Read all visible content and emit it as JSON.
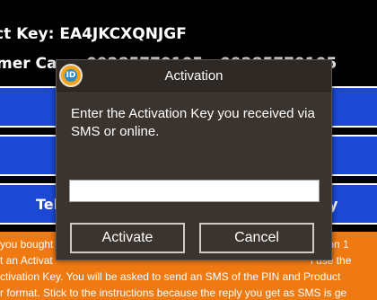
{
  "background": {
    "product_key_line": "ct Key: EA4JKCXQNJGF",
    "customer_care_line": "mer Care: 09285770105 - 09285770105",
    "buttons": [
      {
        "left_label": "",
        "right_label": ""
      },
      {
        "left_label": "",
        "right_label": ""
      },
      {
        "left_label": "Tel",
        "right_label": "y"
      }
    ],
    "info_lines": [
      {
        "left": "you bought",
        "right": "option 1"
      },
      {
        "left": "t an Activat",
        "right": "l use the"
      },
      {
        "left": "ctivation Key.  You will be asked to send an SMS of the PIN and Product",
        "right": ""
      },
      {
        "left": "r format. Stick to the instructions because the reply you get as SMS is ge",
        "right": ""
      }
    ],
    "colors": {
      "button_blue": "#1d48d6",
      "info_orange": "#f07a12"
    }
  },
  "dialog": {
    "title": "Activation",
    "icon": "app-logo-icon",
    "icon_text": "ID",
    "prompt": "Enter the Activation Key you received via SMS or online.",
    "key_input": {
      "value": "",
      "placeholder": ""
    },
    "activate_label": "Activate",
    "cancel_label": "Cancel"
  }
}
